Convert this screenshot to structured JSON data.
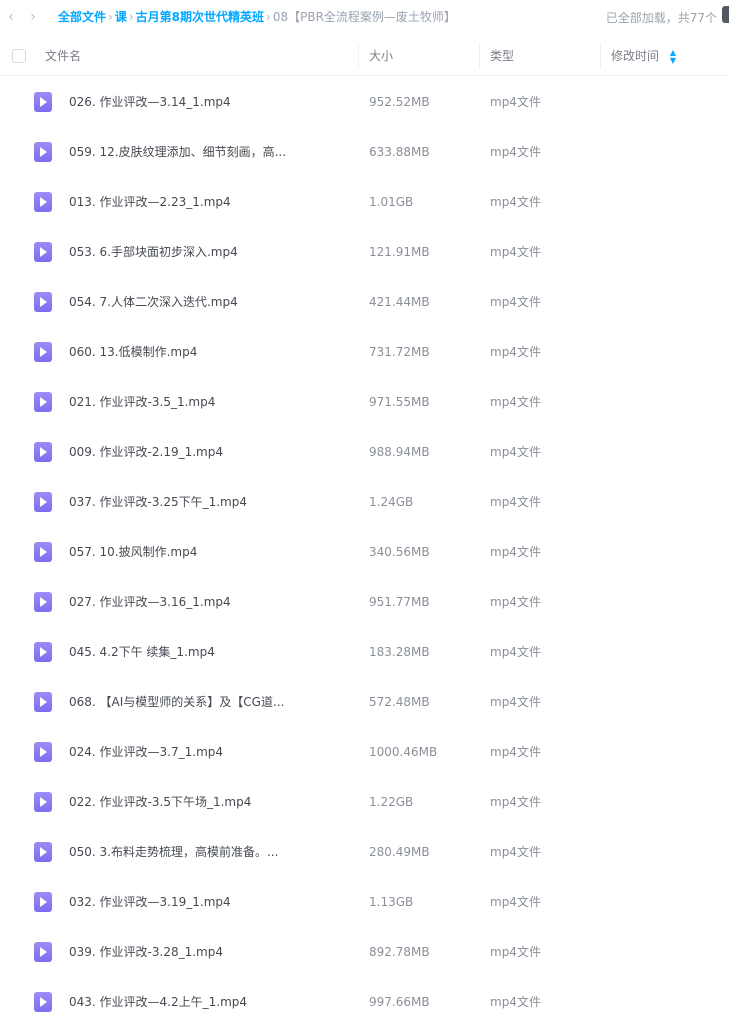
{
  "nav": {
    "back_glyph": "‹",
    "forward_glyph": "›"
  },
  "breadcrumb": {
    "items": [
      "全部文件",
      "课",
      "古月第8期次世代精英班",
      "08【PBR全流程案例—废土牧师】"
    ],
    "separator": "›"
  },
  "status": {
    "text": "已全部加载，共77个"
  },
  "table": {
    "columns": {
      "name": "文件名",
      "size": "大小",
      "type": "类型",
      "modified": "修改时间"
    },
    "sort_icon": "sort-arrows-icon",
    "rows": [
      {
        "name": "026. 作业评改—3.14_1.mp4",
        "size": "952.52MB",
        "type": "mp4文件"
      },
      {
        "name": "059. 12.皮肤纹理添加、细节刻画，高...",
        "size": "633.88MB",
        "type": "mp4文件"
      },
      {
        "name": "013. 作业评改—2.23_1.mp4",
        "size": "1.01GB",
        "type": "mp4文件"
      },
      {
        "name": "053. 6.手部块面初步深入.mp4",
        "size": "121.91MB",
        "type": "mp4文件"
      },
      {
        "name": "054. 7.人体二次深入迭代.mp4",
        "size": "421.44MB",
        "type": "mp4文件"
      },
      {
        "name": "060. 13.低模制作.mp4",
        "size": "731.72MB",
        "type": "mp4文件"
      },
      {
        "name": "021. 作业评改-3.5_1.mp4",
        "size": "971.55MB",
        "type": "mp4文件"
      },
      {
        "name": "009. 作业评改-2.19_1.mp4",
        "size": "988.94MB",
        "type": "mp4文件"
      },
      {
        "name": "037. 作业评改-3.25下午_1.mp4",
        "size": "1.24GB",
        "type": "mp4文件"
      },
      {
        "name": "057. 10.披风制作.mp4",
        "size": "340.56MB",
        "type": "mp4文件"
      },
      {
        "name": "027. 作业评改—3.16_1.mp4",
        "size": "951.77MB",
        "type": "mp4文件"
      },
      {
        "name": "045. 4.2下午 续集_1.mp4",
        "size": "183.28MB",
        "type": "mp4文件"
      },
      {
        "name": "068. 【AI与模型师的关系】及【CG道...",
        "size": "572.48MB",
        "type": "mp4文件"
      },
      {
        "name": "024. 作业评改—3.7_1.mp4",
        "size": "1000.46MB",
        "type": "mp4文件"
      },
      {
        "name": "022. 作业评改-3.5下午场_1.mp4",
        "size": "1.22GB",
        "type": "mp4文件"
      },
      {
        "name": "050. 3.布料走势梳理，高模前准备。...",
        "size": "280.49MB",
        "type": "mp4文件"
      },
      {
        "name": "032. 作业评改—3.19_1.mp4",
        "size": "1.13GB",
        "type": "mp4文件"
      },
      {
        "name": "039. 作业评改-3.28_1.mp4",
        "size": "892.78MB",
        "type": "mp4文件"
      },
      {
        "name": "043. 作业评改—4.2上午_1.mp4",
        "size": "997.66MB",
        "type": "mp4文件"
      }
    ]
  },
  "colors": {
    "accent": "#06a7ff",
    "video_icon": "#8a7cf4"
  }
}
